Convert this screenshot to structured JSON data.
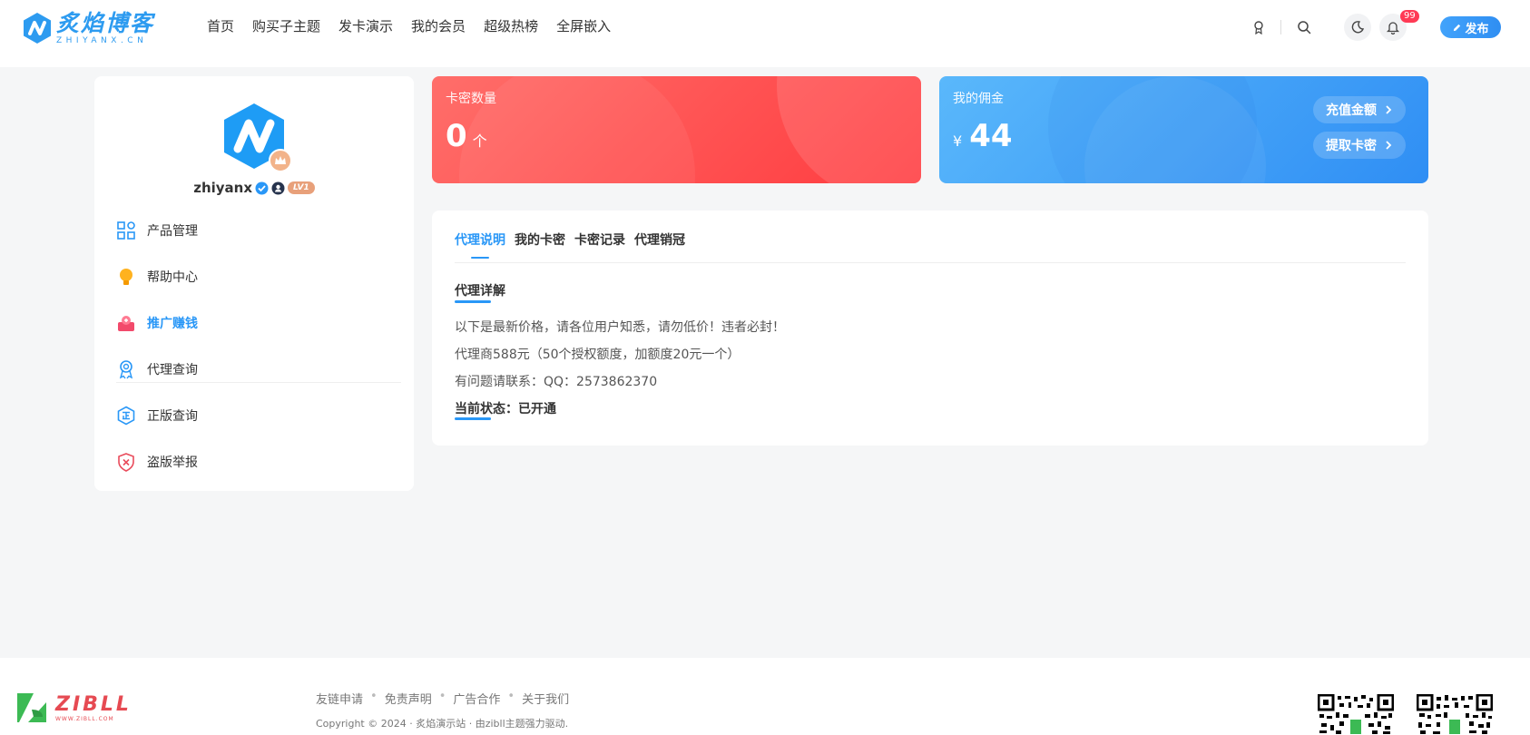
{
  "header": {
    "logo": {
      "title": "炙焰博客",
      "subtitle": "ZHIYANX.CN"
    },
    "nav": [
      "首页",
      "购买子主题",
      "发卡演示",
      "我的会员",
      "超级热榜",
      "全屏嵌入"
    ],
    "notification_count": "99",
    "publish_label": "发布",
    "icons": [
      "medal-icon",
      "search-icon",
      "moon-icon",
      "bell-icon",
      "pen-icon"
    ],
    "accent_color": "#2997f7"
  },
  "sidebar": {
    "username": "zhiyanx",
    "level": "LV1",
    "menu": [
      {
        "label": "产品管理",
        "icon": "grid-icon"
      },
      {
        "label": "帮助中心",
        "icon": "bulb-icon"
      },
      {
        "label": "推广赚钱",
        "icon": "gift-icon",
        "active": true
      },
      {
        "label": "代理查询",
        "icon": "award-icon"
      },
      {
        "label": "正版查询",
        "icon": "hexagon-zheng-icon"
      },
      {
        "label": "盗版举报",
        "icon": "shield-x-icon"
      }
    ]
  },
  "cards": {
    "card_count": {
      "title": "卡密数量",
      "value": "0",
      "unit": "个",
      "color": "#ff4a4a"
    },
    "commission": {
      "title": "我的佣金",
      "currency": "¥",
      "value": "44",
      "color": "#3a9cf6",
      "recharge_label": "充值金额",
      "withdraw_label": "提取卡密"
    }
  },
  "panel": {
    "tabs": [
      "代理说明",
      "我的卡密",
      "卡密记录",
      "代理销冠"
    ],
    "section_title": "代理详解",
    "lines": [
      "以下是最新价格，请各位用户知悉，请勿低价！违者必封！",
      "代理商588元（50个授权额度，加额度20元一个）",
      "有问题请联系：QQ：2573862370"
    ],
    "status": "当前状态：已开通"
  },
  "footer": {
    "logo": {
      "name": "ZIBLL",
      "url": "WWW.ZIBLL.COM"
    },
    "links": [
      "友链申请",
      "免责声明",
      "广告合作",
      "关于我们"
    ],
    "copyright": "Copyright © 2024 · 炙焰演示站 · 由zibll主题强力驱动."
  }
}
